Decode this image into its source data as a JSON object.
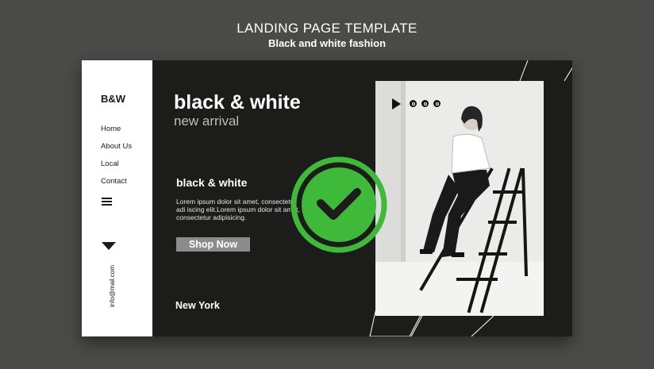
{
  "header": {
    "title": "LANDING PAGE TEMPLATE",
    "subtitle": "Black and white fashion"
  },
  "sidebar": {
    "logo": "B&W",
    "nav": [
      {
        "label": "Home"
      },
      {
        "label": "About Us"
      },
      {
        "label": "Local"
      },
      {
        "label": "Contact"
      }
    ],
    "menu_icon": "hamburger-icon",
    "arrow_icon": "triangle-down-icon",
    "email": "info@mail.com"
  },
  "hero": {
    "title": "black & white",
    "subtitle": "new arrival",
    "section_title": "black & white",
    "body": "Lorem ipsum dolor sit amet, consectetur\nadi iscing elit.Lorem ipsum dolor sit amet,\nconsectetur adipisicing.",
    "cta_label": "Shop Now",
    "location": "New York"
  },
  "media": {
    "play_icon": "play-icon",
    "social_icons": [
      "twitter-icon",
      "instagram-icon",
      "whatsapp-icon"
    ]
  },
  "overlay": {
    "icon": "checkmark-icon",
    "color": "#3fb93a"
  },
  "colors": {
    "background": "#4a4a48",
    "panel_dark": "#1c1c1a",
    "sidebar": "#ffffff",
    "button": "#8c8c8c"
  }
}
